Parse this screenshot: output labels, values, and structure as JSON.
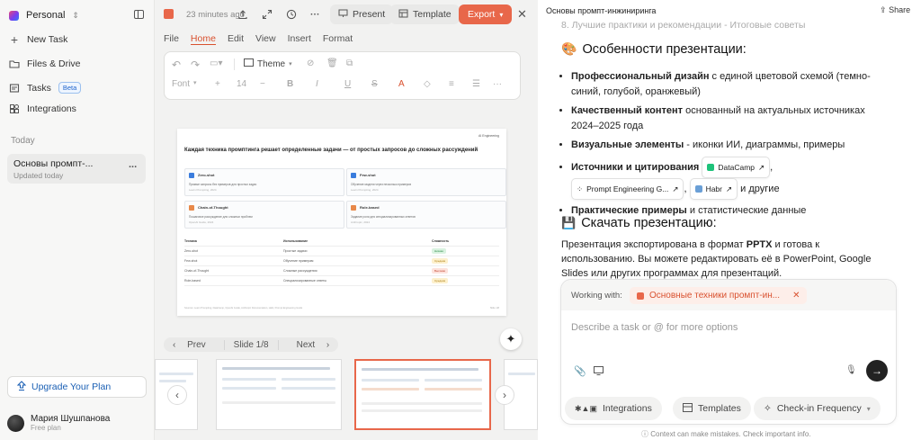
{
  "sidebar": {
    "workspace": "Personal",
    "items": [
      {
        "label": "New Task",
        "icon": "plus-icon"
      },
      {
        "label": "Files & Drive",
        "icon": "folder-icon"
      },
      {
        "label": "Tasks",
        "icon": "tasks-icon",
        "badge": "Beta"
      },
      {
        "label": "Integrations",
        "icon": "integrations-icon"
      }
    ],
    "section": "Today",
    "chat": {
      "title": "Основы промпт-...",
      "subtitle": "Updated today",
      "more": "..."
    },
    "upgrade": "Upgrade Your Plan",
    "user": {
      "name": "Мария Шушпанова",
      "plan": "Free plan"
    }
  },
  "editor": {
    "saved": "23 minutes ago",
    "present": "Present",
    "template": "Template",
    "export": "Export",
    "menu": [
      "File",
      "Home",
      "Edit",
      "View",
      "Insert",
      "Format"
    ],
    "toolbar": {
      "theme": "Theme",
      "font": "Font",
      "size": "14"
    },
    "slide": {
      "brand": "AI Engineering",
      "title": "Каждая техника промптинга решает определенные задачи — от простых запросов до сложных рассуждений",
      "cards": [
        {
          "title": "Zero-shot",
          "desc": "Прямые запросы без примеров для простых задач",
          "src": "Learn Prompting, 2024",
          "color": "#3b7ddd"
        },
        {
          "title": "Few-shot",
          "desc": "Обучение модели через несколько примеров",
          "src": "Learn Prompting, 2024",
          "color": "#3b7ddd"
        },
        {
          "title": "Chain-of-Thought",
          "desc": "Пошаговое рассуждение для сложных проблем",
          "src": "OpenAI Guide, 2024",
          "color": "#e8894a"
        },
        {
          "title": "Role-based",
          "desc": "Задание роли для специализированных ответов",
          "src": "Anthropic, 2024",
          "color": "#e8894a"
        }
      ],
      "table": {
        "headers": [
          "Техника",
          "Использование",
          "Сложность"
        ],
        "rows": [
          [
            "Zero-shot",
            "Простые задачи",
            "Низкая"
          ],
          [
            "Few-shot",
            "Обучение примерам",
            "Средняя"
          ],
          [
            "Chain-of-Thought",
            "Сложные рассуждения",
            "Высокая"
          ],
          [
            "Role-based",
            "Специализированные ответы",
            "Средняя"
          ]
        ]
      },
      "footer": "Sources: Learn Prompting, DataCamp, OpenAI Guide, Anthropic Documentation, Habr, Prompt Engineering Guide",
      "page": "Slide 1/8"
    },
    "nav": {
      "prev": "Prev",
      "slide": "Slide 1/8",
      "next": "Next"
    }
  },
  "chat": {
    "title": "Основы промпт-инжиниринга",
    "share": "Share",
    "faded": "8. Лучшие практики и рекомендации - Итоговые советы",
    "heading1": "Особенности презентации:",
    "b1_bold": "Профессиональный дизайн",
    "b1_rest": " с единой цветовой схемой (темно-синий, голубой, оранжевый)",
    "b2_bold": "Качественный контент",
    "b2_rest": " основанный на актуальных источниках 2024–2025 года",
    "b3_bold": "Визуальные элементы",
    "b3_rest": " - иконки ИИ, диаграммы, примеры",
    "b4_bold": "Источники и цитирования",
    "cite1": "DataCamp",
    "cite2": "Prompt Engineering G...",
    "cite3": "Habr",
    "b4_rest": " и другие",
    "b5_bold": "Практические примеры",
    "b5_rest": " и статистические данные",
    "heading2": "Скачать презентацию:",
    "p1": "Презентация экспортирована в формат ",
    "p1_bold": "PPTX",
    "p1_rest": " и готова к использованию. Вы можете редактировать её в PowerPoint, Google Slides или других программах для презентаций.",
    "working": "Working with:",
    "context": "Основные техники промпт-ин...",
    "placeholder": "Describe a task or @ for more options",
    "tabs": [
      "Integrations",
      "Templates",
      "Check-in Frequency"
    ],
    "note": "Context can make mistakes. Check important info."
  }
}
